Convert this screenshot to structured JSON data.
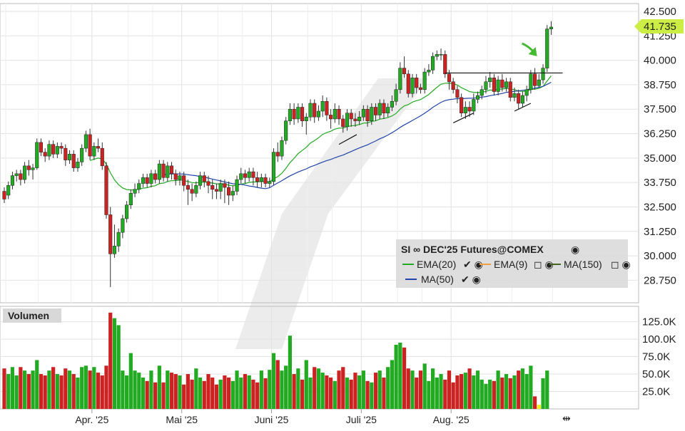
{
  "chart_data": [
    {
      "type": "candlestick",
      "title": "SI ∞ DEC'25 Futures@COMEX",
      "legend_placement": "bottom-right",
      "grid": true,
      "y_axis_position": "right",
      "ylim": [
        27.6,
        42.9
      ],
      "yticks": [
        "42.500",
        "41.250",
        "40.000",
        "38.750",
        "37.500",
        "36.250",
        "35.000",
        "33.750",
        "32.500",
        "31.250",
        "30.000",
        "28.750"
      ],
      "last_price": "41.735",
      "last_price_color": "#ccee44",
      "up_color": "#22aa22",
      "down_color": "#cc2222",
      "x_labels": [
        "Apr. '25",
        "Mai '25",
        "Juni '25",
        "Juli '25",
        "Aug. '25"
      ],
      "x_label_bar_index": [
        22,
        44,
        66,
        88,
        110
      ],
      "candles": [
        [
          33.3,
          32.9,
          33.5,
          32.7
        ],
        [
          33.1,
          33.6,
          33.8,
          32.9
        ],
        [
          33.6,
          34.1,
          34.3,
          33.4
        ],
        [
          34.1,
          34.2,
          34.4,
          33.8
        ],
        [
          34.2,
          33.9,
          34.4,
          33.6
        ],
        [
          33.9,
          34.6,
          34.8,
          33.7
        ],
        [
          34.6,
          34.4,
          34.9,
          34.1
        ],
        [
          34.4,
          34.5,
          34.7,
          33.9
        ],
        [
          34.5,
          35.8,
          36.0,
          34.4
        ],
        [
          35.8,
          35.3,
          36.0,
          35.1
        ],
        [
          35.3,
          35.1,
          35.5,
          34.8
        ],
        [
          35.1,
          35.7,
          35.9,
          34.9
        ],
        [
          35.7,
          35.2,
          35.9,
          35.0
        ],
        [
          35.2,
          35.6,
          35.8,
          35.0
        ],
        [
          35.6,
          35.5,
          35.8,
          35.2
        ],
        [
          35.5,
          34.9,
          35.7,
          34.6
        ],
        [
          34.9,
          35.2,
          35.4,
          34.7
        ],
        [
          35.2,
          34.5,
          35.4,
          34.3
        ],
        [
          34.5,
          34.8,
          35.0,
          34.3
        ],
        [
          34.8,
          35.5,
          35.7,
          34.6
        ],
        [
          35.5,
          36.2,
          36.4,
          35.3
        ],
        [
          36.2,
          35.1,
          36.5,
          34.9
        ],
        [
          35.1,
          35.6,
          35.8,
          34.9
        ],
        [
          35.6,
          35.5,
          36.0,
          35.3
        ],
        [
          35.5,
          34.6,
          35.8,
          34.4
        ],
        [
          34.6,
          32.1,
          34.8,
          31.9
        ],
        [
          32.1,
          30.1,
          32.5,
          28.4
        ],
        [
          30.1,
          30.5,
          31.6,
          29.9
        ],
        [
          30.5,
          31.2,
          31.4,
          30.2
        ],
        [
          31.2,
          31.9,
          32.1,
          30.9
        ],
        [
          31.9,
          32.6,
          32.8,
          31.7
        ],
        [
          32.6,
          33.2,
          33.4,
          32.4
        ],
        [
          33.2,
          33.4,
          33.7,
          33.0
        ],
        [
          33.4,
          33.7,
          33.9,
          33.2
        ],
        [
          33.7,
          34.0,
          34.2,
          33.5
        ],
        [
          34.0,
          33.7,
          34.2,
          33.5
        ],
        [
          33.7,
          34.2,
          34.4,
          33.5
        ],
        [
          34.2,
          33.9,
          34.4,
          33.7
        ],
        [
          33.9,
          34.7,
          34.9,
          33.7
        ],
        [
          34.7,
          34.0,
          34.9,
          33.8
        ],
        [
          34.0,
          34.6,
          34.8,
          33.8
        ],
        [
          34.6,
          34.2,
          34.8,
          33.9
        ],
        [
          34.2,
          33.9,
          34.4,
          33.6
        ],
        [
          33.9,
          34.1,
          34.3,
          33.6
        ],
        [
          34.1,
          33.6,
          34.3,
          33.3
        ],
        [
          33.6,
          33.4,
          33.9,
          32.6
        ],
        [
          33.4,
          33.2,
          33.7,
          32.8
        ],
        [
          33.2,
          33.6,
          33.8,
          33.0
        ],
        [
          33.6,
          34.1,
          34.3,
          33.4
        ],
        [
          34.1,
          33.8,
          34.3,
          33.5
        ],
        [
          33.8,
          33.6,
          34.1,
          33.2
        ],
        [
          33.6,
          33.4,
          33.9,
          32.9
        ],
        [
          33.4,
          33.3,
          33.7,
          32.9
        ],
        [
          33.3,
          33.7,
          33.9,
          32.9
        ],
        [
          33.7,
          33.5,
          33.9,
          32.7
        ],
        [
          33.5,
          33.1,
          33.8,
          32.6
        ],
        [
          33.1,
          33.3,
          33.6,
          32.8
        ],
        [
          33.3,
          33.9,
          34.1,
          33.1
        ],
        [
          33.9,
          34.2,
          34.5,
          33.7
        ],
        [
          34.2,
          34.0,
          34.4,
          33.7
        ],
        [
          34.0,
          34.3,
          34.5,
          33.8
        ],
        [
          34.3,
          34.0,
          34.5,
          33.6
        ],
        [
          34.0,
          33.8,
          34.3,
          33.5
        ],
        [
          33.8,
          34.0,
          34.2,
          33.5
        ],
        [
          34.0,
          33.7,
          34.2,
          33.5
        ],
        [
          33.7,
          33.8,
          34.0,
          33.5
        ],
        [
          33.8,
          35.3,
          35.5,
          33.6
        ],
        [
          35.3,
          35.1,
          35.8,
          34.8
        ],
        [
          35.1,
          35.9,
          36.1,
          34.9
        ],
        [
          35.9,
          36.9,
          37.1,
          35.7
        ],
        [
          36.9,
          37.5,
          37.8,
          36.7
        ],
        [
          37.5,
          37.0,
          37.8,
          36.7
        ],
        [
          37.0,
          37.6,
          37.8,
          36.8
        ],
        [
          37.6,
          36.9,
          37.8,
          36.6
        ],
        [
          36.9,
          37.1,
          37.3,
          36.2
        ],
        [
          37.1,
          37.8,
          38.0,
          36.9
        ],
        [
          37.8,
          37.1,
          38.0,
          36.8
        ],
        [
          37.1,
          37.4,
          37.7,
          36.9
        ],
        [
          37.4,
          37.9,
          38.2,
          37.1
        ],
        [
          37.9,
          37.2,
          38.1,
          36.9
        ],
        [
          37.2,
          37.0,
          37.5,
          36.5
        ],
        [
          37.0,
          37.5,
          37.8,
          36.8
        ],
        [
          37.5,
          37.0,
          37.7,
          36.7
        ],
        [
          37.0,
          36.6,
          37.2,
          36.3
        ],
        [
          36.6,
          37.3,
          37.5,
          36.4
        ],
        [
          37.3,
          37.0,
          37.5,
          36.6
        ],
        [
          37.0,
          36.9,
          37.3,
          36.6
        ],
        [
          36.9,
          37.1,
          37.4,
          36.7
        ],
        [
          37.1,
          37.5,
          37.7,
          36.9
        ],
        [
          37.5,
          36.9,
          37.7,
          36.6
        ],
        [
          36.9,
          37.6,
          37.8,
          36.7
        ],
        [
          37.6,
          37.2,
          37.8,
          36.9
        ],
        [
          37.2,
          37.8,
          38.0,
          37.0
        ],
        [
          37.8,
          37.3,
          38.0,
          37.0
        ],
        [
          37.3,
          37.6,
          37.8,
          37.1
        ],
        [
          37.6,
          37.9,
          38.2,
          37.4
        ],
        [
          37.9,
          38.5,
          38.8,
          37.7
        ],
        [
          38.5,
          39.6,
          39.9,
          38.3
        ],
        [
          39.6,
          39.3,
          40.2,
          39.1
        ],
        [
          39.3,
          38.3,
          39.5,
          38.1
        ],
        [
          38.3,
          39.1,
          39.3,
          38.1
        ],
        [
          39.1,
          38.6,
          39.3,
          38.3
        ],
        [
          38.6,
          38.5,
          38.8,
          38.3
        ],
        [
          38.5,
          39.4,
          39.6,
          38.3
        ],
        [
          39.4,
          39.5,
          39.8,
          39.2
        ],
        [
          39.5,
          40.2,
          40.4,
          39.3
        ],
        [
          40.2,
          40.3,
          40.5,
          40.0
        ],
        [
          40.3,
          40.3,
          40.6,
          40.0
        ],
        [
          40.3,
          39.3,
          40.5,
          39.1
        ],
        [
          39.3,
          38.9,
          39.5,
          38.5
        ],
        [
          38.9,
          38.5,
          39.1,
          38.3
        ],
        [
          38.5,
          38.1,
          38.7,
          37.8
        ],
        [
          38.1,
          37.3,
          38.3,
          37.1
        ],
        [
          37.3,
          37.6,
          37.9,
          37.0
        ],
        [
          37.6,
          37.4,
          37.9,
          37.1
        ],
        [
          37.4,
          38.0,
          38.3,
          37.2
        ],
        [
          38.0,
          38.2,
          38.4,
          37.8
        ],
        [
          38.2,
          38.5,
          38.7,
          38.0
        ],
        [
          38.5,
          38.9,
          39.2,
          38.3
        ],
        [
          38.9,
          39.1,
          39.4,
          38.6
        ],
        [
          39.1,
          38.4,
          39.3,
          38.2
        ],
        [
          38.4,
          39.0,
          39.2,
          38.2
        ],
        [
          39.0,
          38.6,
          39.3,
          38.4
        ],
        [
          38.6,
          38.9,
          39.1,
          38.4
        ],
        [
          38.9,
          38.1,
          39.1,
          37.9
        ],
        [
          38.1,
          38.3,
          38.6,
          37.9
        ],
        [
          38.3,
          37.8,
          38.5,
          37.5
        ],
        [
          37.8,
          38.2,
          38.4,
          37.6
        ],
        [
          38.2,
          38.5,
          38.7,
          37.9
        ],
        [
          38.5,
          39.3,
          39.5,
          38.3
        ],
        [
          39.3,
          38.7,
          39.6,
          38.5
        ],
        [
          38.7,
          39.0,
          39.3,
          38.6
        ],
        [
          39.0,
          39.6,
          39.8,
          38.8
        ],
        [
          39.6,
          41.6,
          41.8,
          39.4
        ],
        [
          41.6,
          41.7,
          42.0,
          41.3
        ]
      ],
      "volume": {
        "title": "Volumen",
        "ylim": [
          0,
          145000
        ],
        "yticks": [
          "125.0K",
          "100.0K",
          "75.0K",
          "50.0K",
          "25.0K"
        ],
        "tick_values": [
          125000,
          100000,
          75000,
          50000,
          25000
        ],
        "values": [
          58,
          50,
          60,
          48,
          60,
          55,
          50,
          55,
          70,
          50,
          48,
          55,
          60,
          50,
          48,
          58,
          55,
          50,
          45,
          60,
          62,
          55,
          60,
          52,
          48,
          62,
          138,
          130,
          120,
          55,
          48,
          80,
          55,
          52,
          45,
          40,
          55,
          38,
          62,
          38,
          55,
          52,
          50,
          48,
          35,
          50,
          42,
          58,
          45,
          40,
          50,
          45,
          35,
          42,
          48,
          45,
          40,
          55,
          45,
          50,
          48,
          42,
          38,
          55,
          44,
          56,
          80,
          70,
          55,
          62,
          105,
          50,
          58,
          42,
          70,
          45,
          60,
          58,
          52,
          48,
          45,
          40,
          55,
          60,
          45,
          42,
          52,
          48,
          55,
          40,
          38,
          52,
          55,
          45,
          60,
          70,
          92,
          95,
          88,
          58,
          55,
          45,
          55,
          65,
          40,
          58,
          45,
          50,
          42,
          55,
          38,
          48,
          50,
          52,
          58,
          48,
          55,
          42,
          36,
          42,
          40,
          55,
          45,
          50,
          44,
          48,
          55,
          58,
          50,
          62,
          18,
          6,
          44,
          55
        ],
        "highlight_index": 131,
        "highlight_color": "#eeee22"
      },
      "series": [
        {
          "name": "EMA(20)",
          "color": "#22aa22",
          "legend_icons": "✔ ◉"
        },
        {
          "name": "EMA(9)",
          "color": "#f0a040",
          "legend_icons": "◻ ◉"
        },
        {
          "name": "MA(150)",
          "color": "#446622",
          "legend_icons": "◻ ◉"
        },
        {
          "name": "MA(50)",
          "color": "#2244aa",
          "legend_icons": "✔ ◉"
        }
      ],
      "resistance_level": 39.35,
      "annotation": "green-arrow"
    }
  ]
}
